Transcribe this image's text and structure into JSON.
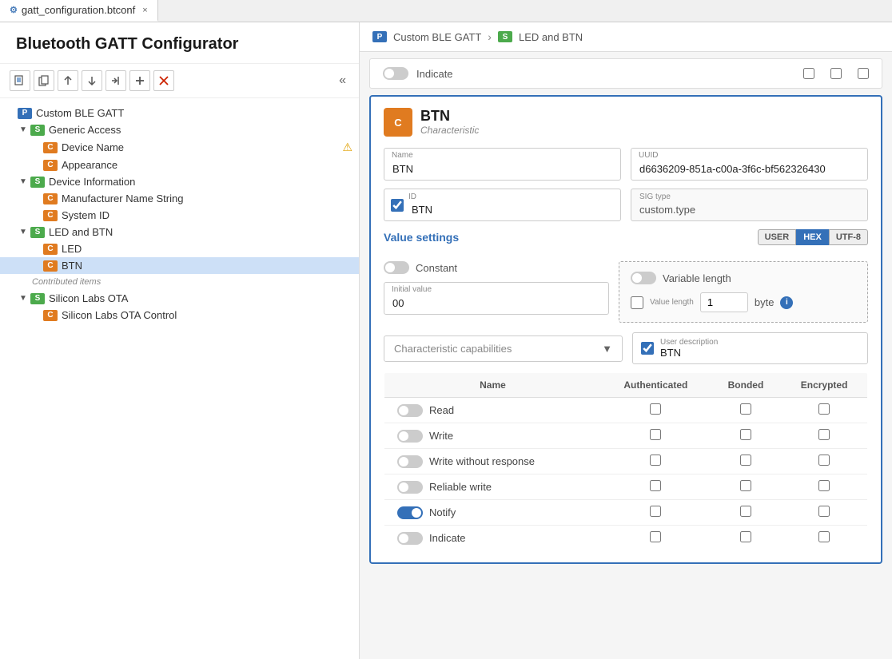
{
  "tab": {
    "filename": "gatt_configuration.btconf",
    "close_label": "×"
  },
  "app_title": "Bluetooth GATT Configurator",
  "toolbar": {
    "new_label": "⊞",
    "copy_label": "⧉",
    "up_label": "↑",
    "down_label": "↓",
    "import_label": "⇥",
    "add_label": "+",
    "delete_label": "×",
    "collapse_label": "«"
  },
  "tree": {
    "items": [
      {
        "id": "custom-ble-gatt",
        "badge": "P",
        "badge_class": "badge-p",
        "label": "Custom BLE GATT",
        "indent": 0,
        "arrow": "",
        "selected": false,
        "warn": false
      },
      {
        "id": "generic-access",
        "badge": "S",
        "badge_class": "badge-s",
        "label": "Generic Access",
        "indent": 1,
        "arrow": "▼",
        "selected": false,
        "warn": false
      },
      {
        "id": "device-name",
        "badge": "C",
        "badge_class": "badge-c",
        "label": "Device Name",
        "indent": 2,
        "arrow": "",
        "selected": false,
        "warn": true
      },
      {
        "id": "appearance",
        "badge": "C",
        "badge_class": "badge-c",
        "label": "Appearance",
        "indent": 2,
        "arrow": "",
        "selected": false,
        "warn": false
      },
      {
        "id": "device-info",
        "badge": "S",
        "badge_class": "badge-s",
        "label": "Device Information",
        "indent": 1,
        "arrow": "▼",
        "selected": false,
        "warn": false
      },
      {
        "id": "manufacturer-name",
        "badge": "C",
        "badge_class": "badge-c",
        "label": "Manufacturer Name String",
        "indent": 2,
        "arrow": "",
        "selected": false,
        "warn": false
      },
      {
        "id": "system-id",
        "badge": "C",
        "badge_class": "badge-c",
        "label": "System ID",
        "indent": 2,
        "arrow": "",
        "selected": false,
        "warn": false
      },
      {
        "id": "led-btn",
        "badge": "S",
        "badge_class": "badge-s",
        "label": "LED and BTN",
        "indent": 1,
        "arrow": "▼",
        "selected": false,
        "warn": false
      },
      {
        "id": "led",
        "badge": "C",
        "badge_class": "badge-c",
        "label": "LED",
        "indent": 2,
        "arrow": "",
        "selected": false,
        "warn": false
      },
      {
        "id": "btn",
        "badge": "C",
        "badge_class": "badge-c",
        "label": "BTN",
        "indent": 2,
        "arrow": "",
        "selected": true,
        "warn": false
      }
    ],
    "contributed_label": "Contributed items",
    "contrib_items": [
      {
        "id": "silicon-labs-ota",
        "badge": "S",
        "badge_class": "badge-s",
        "label": "Silicon Labs OTA",
        "indent": 1,
        "arrow": "▼",
        "selected": false,
        "warn": false
      },
      {
        "id": "silicon-labs-ota-control",
        "badge": "C",
        "badge_class": "badge-c",
        "label": "Silicon Labs OTA Control",
        "indent": 2,
        "arrow": "",
        "selected": false,
        "warn": false
      }
    ]
  },
  "breadcrumb": {
    "p_label": "P",
    "p_text": "Custom BLE GATT",
    "sep": ">",
    "s_label": "S",
    "s_text": "LED and BTN"
  },
  "indicate_row": {
    "label": "Indicate"
  },
  "characteristic": {
    "icon_label": "C",
    "name": "BTN",
    "subtitle": "Characteristic",
    "fields": {
      "name_label": "Name",
      "name_value": "BTN",
      "uuid_label": "UUID",
      "uuid_value": "d6636209-851a-c00a-3f6c-bf562326430",
      "id_label": "ID",
      "id_value": "BTN",
      "id_checked": true,
      "sig_type_label": "SIG type",
      "sig_type_value": "custom.type"
    },
    "value_settings": {
      "title": "Value settings",
      "format_buttons": [
        {
          "label": "USER",
          "active": false
        },
        {
          "label": "HEX",
          "active": true
        },
        {
          "label": "UTF-8",
          "active": false
        }
      ],
      "constant_label": "Constant",
      "constant_on": false,
      "variable_length_label": "Variable length",
      "variable_length_on": false,
      "initial_value_label": "Initial value",
      "initial_value": "00",
      "value_length_label": "Value length",
      "value_length": "1",
      "value_length_unit": "byte",
      "value_length_checked": false
    },
    "capabilities": {
      "placeholder": "Characteristic capabilities",
      "user_desc_label": "User description",
      "user_desc_checked": true,
      "user_desc_value": "BTN",
      "table": {
        "headers": [
          "Name",
          "Authenticated",
          "Bonded",
          "Encrypted"
        ],
        "rows": [
          {
            "name": "Read",
            "authenticated": false,
            "bonded": false,
            "encrypted": false,
            "toggle_on": false
          },
          {
            "name": "Write",
            "authenticated": false,
            "bonded": false,
            "encrypted": false,
            "toggle_on": false
          },
          {
            "name": "Write without response",
            "authenticated": false,
            "bonded": false,
            "encrypted": false,
            "toggle_on": false
          },
          {
            "name": "Reliable write",
            "authenticated": false,
            "bonded": false,
            "encrypted": false,
            "toggle_on": false
          },
          {
            "name": "Notify",
            "authenticated": false,
            "bonded": false,
            "encrypted": false,
            "toggle_on": true
          },
          {
            "name": "Indicate",
            "authenticated": false,
            "bonded": false,
            "encrypted": false,
            "toggle_on": false
          }
        ]
      }
    }
  }
}
